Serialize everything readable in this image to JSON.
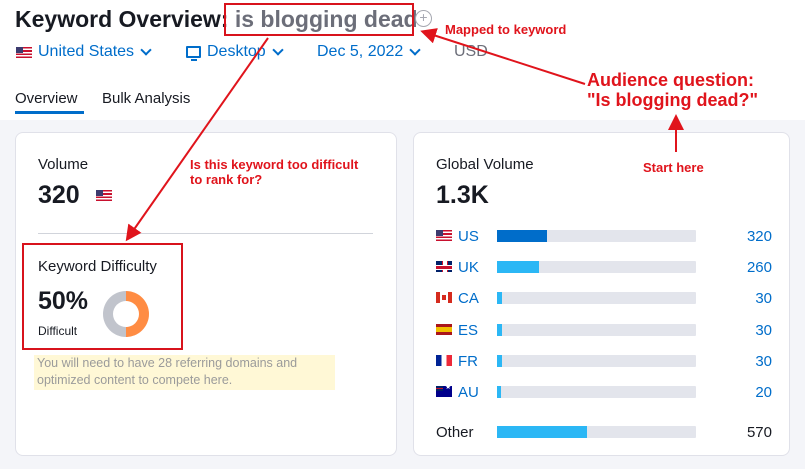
{
  "header": {
    "title_prefix": "Keyword Overview:",
    "keyword": "is blogging dead",
    "filters": {
      "country": "United States",
      "device": "Desktop",
      "date": "Dec 5, 2022",
      "currency": "USD"
    },
    "tabs": [
      {
        "label": "Overview",
        "active": true
      },
      {
        "label": "Bulk Analysis",
        "active": false
      }
    ]
  },
  "volume": {
    "label": "Volume",
    "value": "320"
  },
  "difficulty": {
    "label": "Keyword Difficulty",
    "value": "50%",
    "percent": 50,
    "level": "Difficult",
    "hint": "You will need to have 28 referring domains and optimized content to compete here."
  },
  "global": {
    "label": "Global Volume",
    "value": "1.3K",
    "countries": [
      {
        "code": "US",
        "value": "320",
        "fraction": 0.25,
        "flag": "us-flag-icon",
        "color": "#006dca"
      },
      {
        "code": "UK",
        "value": "260",
        "fraction": 0.21,
        "flag": "uk-flag-icon",
        "color": "#2bb7f5"
      },
      {
        "code": "CA",
        "value": "30",
        "fraction": 0.025,
        "flag": "ca-flag-icon",
        "color": "#2bb7f5"
      },
      {
        "code": "ES",
        "value": "30",
        "fraction": 0.025,
        "flag": "es-flag-icon",
        "color": "#2bb7f5"
      },
      {
        "code": "FR",
        "value": "30",
        "fraction": 0.025,
        "flag": "fr-flag-icon",
        "color": "#2bb7f5"
      },
      {
        "code": "AU",
        "value": "20",
        "fraction": 0.02,
        "flag": "au-flag-icon",
        "color": "#2bb7f5"
      }
    ],
    "other": {
      "label": "Other",
      "value": "570",
      "fraction": 0.45,
      "color": "#2bb7f5"
    }
  },
  "annotations": {
    "mapped": "Mapped to keyword",
    "audience_line1": "Audience question:",
    "audience_line2": "\"Is blogging dead?\"",
    "start": "Start here",
    "difficult_line1": "Is this keyword too difficult",
    "difficult_line2": "to rank for?"
  },
  "colors": {
    "accent": "#006dca",
    "annotation_red": "#e0141c",
    "donut_orange": "#ff8c43"
  }
}
